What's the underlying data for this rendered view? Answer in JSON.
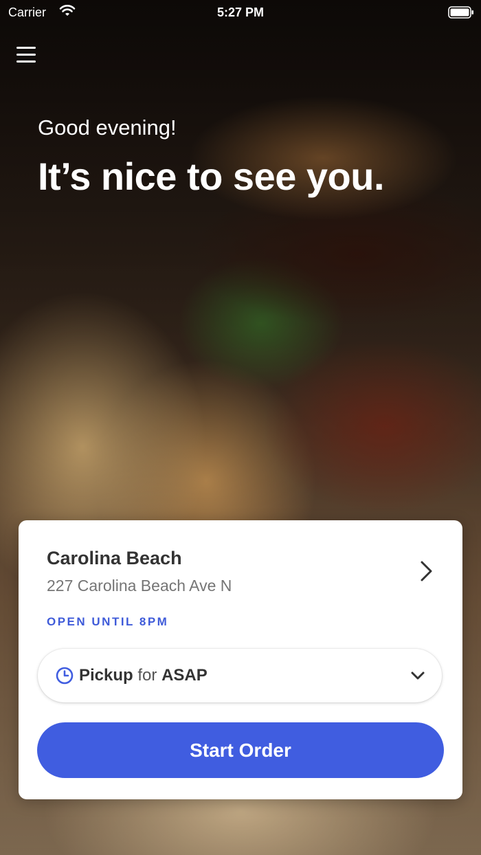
{
  "status_bar": {
    "carrier": "Carrier",
    "time": "5:27 PM"
  },
  "hero": {
    "greeting": "Good evening!",
    "headline": "It’s nice to see you."
  },
  "location_card": {
    "name": "Carolina Beach",
    "address": "227 Carolina Beach Ave N",
    "hours": "OPEN UNTIL 8PM",
    "order_mode": {
      "mode": "Pickup",
      "connector": "for",
      "time": "ASAP"
    },
    "start_button": "Start Order"
  },
  "colors": {
    "accent": "#405de0",
    "hours_text": "#3f5bd9",
    "card_bg": "#ffffff",
    "title_text": "#333333",
    "address_text": "#757575"
  },
  "icons": [
    "wifi-icon",
    "battery-icon",
    "menu-icon",
    "chevron-right-icon",
    "clock-icon",
    "chevron-down-icon"
  ]
}
